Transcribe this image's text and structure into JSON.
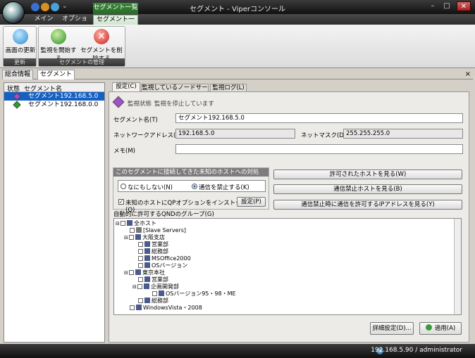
{
  "window": {
    "title": "セグメント - Viperコンソール",
    "context_tab_header": "セグメント一覧"
  },
  "ribbon": {
    "tabs": [
      "メイン",
      "オプション",
      "セグメント一覧"
    ],
    "groups": [
      {
        "label": "更新",
        "buttons": [
          {
            "label": "画面の更新",
            "icon": "refresh-icon"
          }
        ]
      },
      {
        "label": "セグメントの管理",
        "buttons": [
          {
            "label": "監視を開始する",
            "icon": "start-monitor-icon"
          },
          {
            "label": "セグメントを削除する",
            "icon": "delete-icon"
          }
        ]
      }
    ]
  },
  "doc_tabs": [
    "総合情報",
    "セグメント"
  ],
  "segment_list": {
    "headers": [
      "状態",
      "セグメント名"
    ],
    "rows": [
      {
        "name": "セグメント192.168.5.0",
        "status_color": "#a050c8",
        "selected": true
      },
      {
        "name": "セグメント192.168.0.0",
        "status_color": "#2ca02c",
        "selected": false
      }
    ]
  },
  "detail": {
    "tabs": [
      "設定(C)",
      "監視しているノードサーバ(X)",
      "監視ログ(L)"
    ],
    "status_label": "監視状態",
    "status_value": "監視を停止しています",
    "segment_name_label": "セグメント名(T)",
    "segment_name": "セグメント192.168.5.0",
    "network_label": "ネットワークアドレス(N)",
    "network": "192.168.5.0",
    "netmask_label": "ネットマスク(D)",
    "netmask": "255.255.255.0",
    "memo_label": "メモ(M)",
    "memo": "",
    "unknown_group_title": "このセグメントに接続してきた未知のホストへの対処",
    "radio_nothing": "なにもしない(N)",
    "radio_block": "通信を禁止する(K)",
    "install_check": "未知のホストにQPオプションをインストールする(Q)",
    "settings_button": "設定(P)",
    "view_allowed_button": "許可されたホストを見る(W)",
    "view_blocked_button": "通信禁止ホストを見る(B)",
    "view_allowed_ip_button": "通信禁止時に通信を許可するIPアドレスを見る(Y)",
    "groups_label": "自動的に許可するQNDのグループ(G)",
    "tree": [
      {
        "label": "全ホスト",
        "level": 0
      },
      {
        "label": "[Slave Servers]",
        "level": 1
      },
      {
        "label": "大阪支店",
        "level": 1
      },
      {
        "label": "営業部",
        "level": 2
      },
      {
        "label": "総務部",
        "level": 2
      },
      {
        "label": "MSOffice2000",
        "level": 2
      },
      {
        "label": "OSバージョン",
        "level": 2
      },
      {
        "label": "東京本社",
        "level": 1
      },
      {
        "label": "営業部",
        "level": 2
      },
      {
        "label": "企画開発部",
        "level": 2
      },
      {
        "label": "OSバージョン95・98・ME",
        "level": 3
      },
      {
        "label": "総務部",
        "level": 2
      },
      {
        "label": "WindowsVista・2008",
        "level": 1
      }
    ],
    "advanced_button": "詳細設定(D)...",
    "apply_button": "適用(A)"
  },
  "statusbar": {
    "text": "192.168.5.90 / administrator"
  }
}
